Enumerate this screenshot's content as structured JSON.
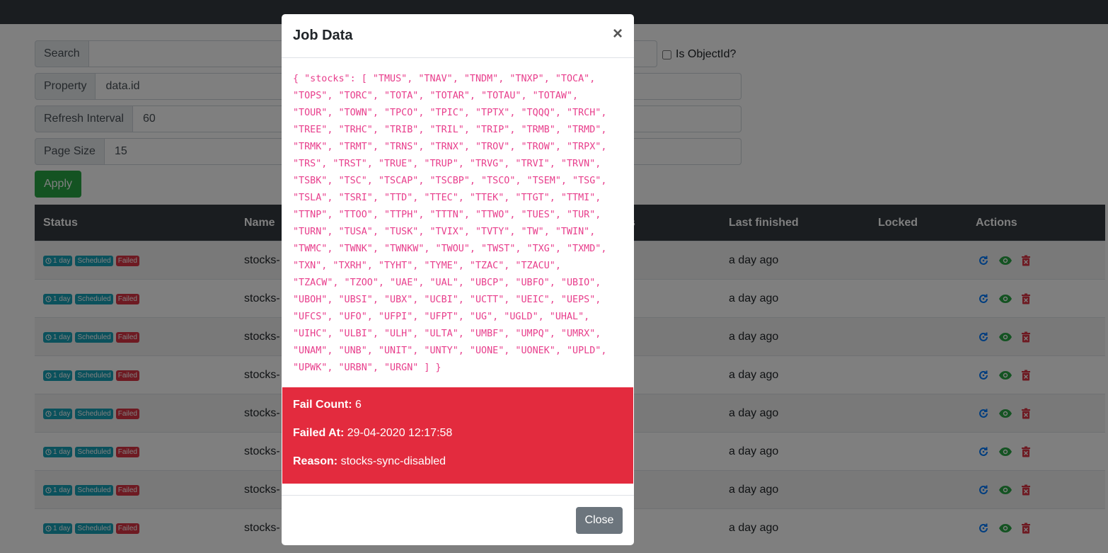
{
  "filters": {
    "search_label": "Search",
    "search_value": "",
    "objectid_label": "Is ObjectId?",
    "property_label": "Property",
    "property_value": "data.id",
    "refresh_label": "Refresh Interval",
    "refresh_value": "60",
    "pagesize_label": "Page Size",
    "pagesize_value": "15",
    "apply_label": "Apply"
  },
  "table": {
    "headers": [
      "Status",
      "Name",
      "s",
      "Last finished",
      "Locked",
      "Actions"
    ],
    "rows": [
      {
        "repeat": "1 day",
        "scheduled": "Scheduled",
        "failed": "Failed",
        "name": "stocks-",
        "last_finished": "a day ago"
      },
      {
        "repeat": "1 day",
        "scheduled": "Scheduled",
        "failed": "Failed",
        "name": "stocks-",
        "last_finished": "a day ago"
      },
      {
        "repeat": "1 day",
        "scheduled": "Scheduled",
        "failed": "Failed",
        "name": "stocks-",
        "last_finished": "a day ago"
      },
      {
        "repeat": "1 day",
        "scheduled": "Scheduled",
        "failed": "Failed",
        "name": "stocks-",
        "last_finished": "a day ago"
      },
      {
        "repeat": "1 day",
        "scheduled": "Scheduled",
        "failed": "Failed",
        "name": "stocks-",
        "last_finished": "a day ago"
      },
      {
        "repeat": "1 day",
        "scheduled": "Scheduled",
        "failed": "Failed",
        "name": "stocks-",
        "last_finished": "a day ago"
      },
      {
        "repeat": "1 day",
        "scheduled": "Scheduled",
        "failed": "Failed",
        "name": "stocks-",
        "last_finished": "a day ago"
      },
      {
        "repeat": "1 day",
        "scheduled": "Scheduled",
        "failed": "Failed",
        "name": "stocks-",
        "last_finished": "a day ago"
      }
    ]
  },
  "modal": {
    "title": "Job Data",
    "close_x": "×",
    "json_text": "{ \"stocks\": [ \"TMUS\", \"TNAV\", \"TNDM\", \"TNXP\", \"TOCA\",\n\"TOPS\", \"TORC\", \"TOTA\", \"TOTAR\", \"TOTAU\", \"TOTAW\",\n\"TOUR\", \"TOWN\", \"TPCO\", \"TPIC\", \"TPTX\", \"TQQQ\", \"TRCH\",\n\"TREE\", \"TRHC\", \"TRIB\", \"TRIL\", \"TRIP\", \"TRMB\", \"TRMD\",\n\"TRMK\", \"TRMT\", \"TRNS\", \"TRNX\", \"TROV\", \"TROW\", \"TRPX\",\n\"TRS\", \"TRST\", \"TRUE\", \"TRUP\", \"TRVG\", \"TRVI\", \"TRVN\",\n\"TSBK\", \"TSC\", \"TSCAP\", \"TSCBP\", \"TSCO\", \"TSEM\", \"TSG\",\n\"TSLA\", \"TSRI\", \"TTD\", \"TTEC\", \"TTEK\", \"TTGT\", \"TTMI\",\n\"TTNP\", \"TTOO\", \"TTPH\", \"TTTN\", \"TTWO\", \"TUES\", \"TUR\",\n\"TURN\", \"TUSA\", \"TUSK\", \"TVIX\", \"TVTY\", \"TW\", \"TWIN\",\n\"TWMC\", \"TWNK\", \"TWNKW\", \"TWOU\", \"TWST\", \"TXG\", \"TXMD\",\n\"TXN\", \"TXRH\", \"TYHT\", \"TYME\", \"TZAC\", \"TZACU\",\n\"TZACW\", \"TZOO\", \"UAE\", \"UAL\", \"UBCP\", \"UBFO\", \"UBIO\",\n\"UBOH\", \"UBSI\", \"UBX\", \"UCBI\", \"UCTT\", \"UEIC\", \"UEPS\",\n\"UFCS\", \"UFO\", \"UFPI\", \"UFPT\", \"UG\", \"UGLD\", \"UHAL\",\n\"UIHC\", \"ULBI\", \"ULH\", \"ULTA\", \"UMBF\", \"UMPQ\", \"UMRX\",\n\"UNAM\", \"UNB\", \"UNIT\", \"UNTY\", \"UONE\", \"UONEK\", \"UPLD\",\n\"UPWK\", \"URBN\", \"URGN\" ] }",
    "fail_count_label": "Fail Count:",
    "fail_count_value": " 6",
    "failed_at_label": "Failed At:",
    "failed_at_value": " 29-04-2020 12:17:58",
    "reason_label": "Reason:",
    "reason_value": " stocks-sync-disabled",
    "close_button": "Close"
  },
  "colors": {
    "topbar": "#343a40",
    "apply": "#28a745",
    "badge_info": "#17a2b8",
    "badge_danger": "#dc3545",
    "alert": "#e32b3e",
    "json_text": "#e83e8c",
    "close_button": "#6c757d"
  },
  "icons": {
    "repeat": "clock-icon",
    "requeue": "refresh-icon",
    "view": "eye-icon",
    "delete": "trash-icon"
  }
}
